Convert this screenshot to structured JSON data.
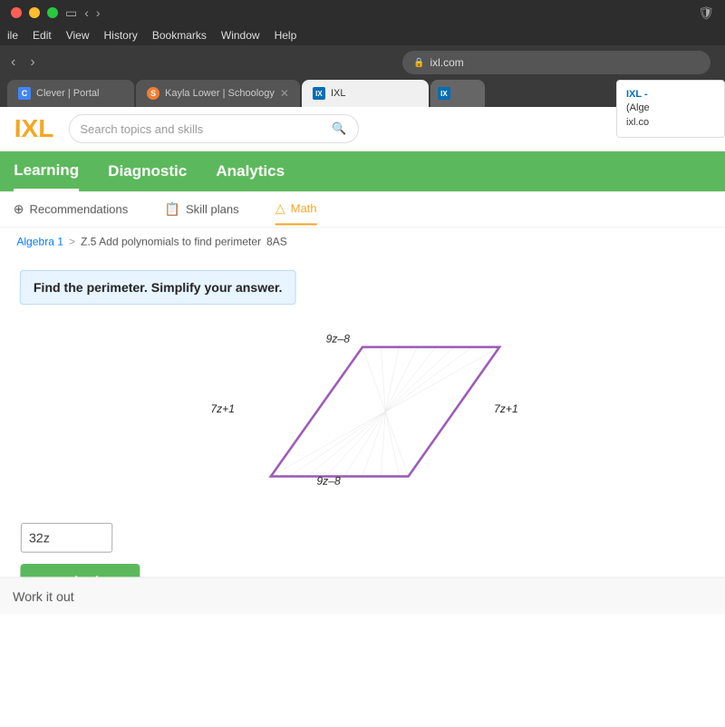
{
  "os": {
    "menu_items": [
      "ile",
      "Edit",
      "View",
      "History",
      "Bookmarks",
      "Window",
      "Help"
    ]
  },
  "browser": {
    "tabs": [
      {
        "label": "Clever | Portal",
        "favicon_type": "clever",
        "favicon_letter": "C",
        "active": false
      },
      {
        "label": "Kayla Lower | Schoology",
        "favicon_type": "schoology",
        "favicon_letter": "S",
        "active": false
      },
      {
        "label": "IXL",
        "favicon_type": "ixl",
        "favicon_letter": "IX",
        "active": true
      }
    ],
    "address": "ixl.com",
    "ixl_popup": {
      "title": "IXL -",
      "subtitle": "(Alge",
      "url": "ixl.co"
    }
  },
  "ixl": {
    "logo_text": "IXL",
    "search_placeholder": "Search topics and skills",
    "nav": {
      "learning": "Learning",
      "diagnostic": "Diagnostic",
      "analytics": "Analytics"
    },
    "sub_nav": {
      "recommendations": "Recommendations",
      "skill_plans": "Skill plans",
      "math": "Math"
    },
    "breadcrumb": {
      "parent": "Algebra 1",
      "separator": ">",
      "current": "Z.5 Add polynomials to find perimeter",
      "code": "8AS"
    },
    "question": {
      "prompt": "Find the perimeter. Simplify your answer.",
      "sides": {
        "top": "9z–8",
        "bottom": "9z–8",
        "left": "7z+1",
        "right": "7z+1"
      },
      "answer_value": "32z",
      "submit_label": "Submit"
    },
    "work_out": "Work it out"
  }
}
